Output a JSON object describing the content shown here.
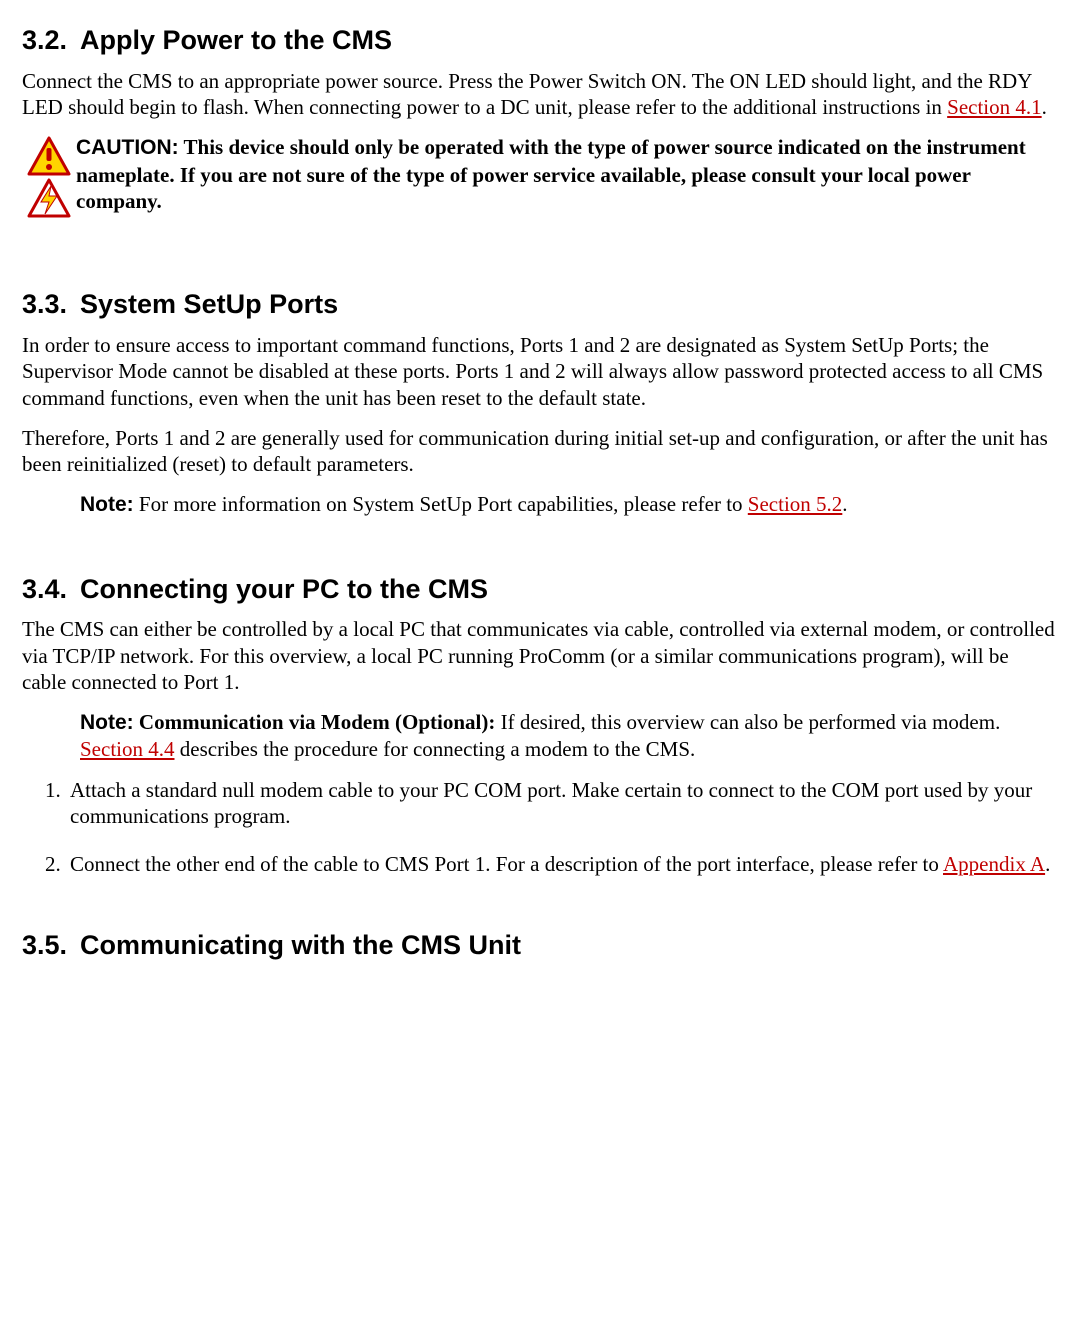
{
  "s32": {
    "num": "3.2.",
    "title": "Apply Power to the CMS",
    "para_a": "Connect the CMS to an appropriate power source. Press the Power Switch ON.  The ON LED should light, and the RDY LED should begin to flash. When connecting power to a DC unit, please refer to the additional instructions in ",
    "link": "Section 4.1",
    "para_b": ".",
    "caution_label": "CAUTION:",
    "caution_body": "  This device should only be operated with the type of power source indicated on the instrument nameplate. If you are not sure of the type of power service available, please consult your local power company."
  },
  "s33": {
    "num": "3.3.",
    "title": "System SetUp Ports",
    "p1": "In order to ensure access to important command functions, Ports 1 and 2 are designated as System SetUp Ports; the Supervisor Mode cannot be disabled at these ports. Ports 1 and 2 will always allow password protected access to all CMS command functions, even when the unit has been reset to the default state.",
    "p2": "Therefore, Ports 1 and 2 are generally used for communication during initial set-up and configuration, or after the unit has been reinitialized (reset) to default parameters.",
    "note_label": "Note:",
    "note_body": "  For more information on System SetUp Port capabilities, please refer to ",
    "note_link": "Section 5.2",
    "note_tail": "."
  },
  "s34": {
    "num": "3.4.",
    "title": "Connecting your PC to the CMS",
    "p1": "The CMS can either be controlled by a local PC that communicates via cable, controlled via external modem, or controlled via TCP/IP network.  For this overview, a local PC running ProComm (or a similar communications program), will be cable connected to Port 1.",
    "note_label": "Note:",
    "note_bold": "  Communication via Modem (Optional):",
    "note_body_a": "  If desired, this overview can also be performed via modem. ",
    "note_link": "Section 4.4",
    "note_body_b": " describes the procedure for connecting a modem to the CMS.",
    "li1": "Attach a standard null modem cable to your PC COM port. Make certain to connect to the COM port used by your communications program.",
    "li2_a": "Connect the other end of the cable to CMS Port 1. For a description of the port interface, please refer to ",
    "li2_link": "Appendix A",
    "li2_b": "."
  },
  "s35": {
    "num": "3.5.",
    "title": "Communicating with the CMS Unit"
  }
}
